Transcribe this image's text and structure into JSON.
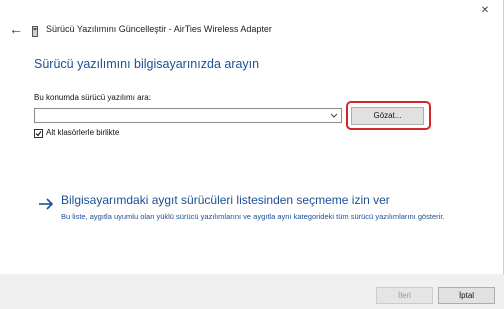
{
  "window": {
    "title": "Sürücü Yazılımını Güncelleştir - AirTies Wireless Adapter",
    "close_glyph": "✕",
    "back_glyph": "←",
    "back_icon": "back-arrow-icon",
    "app_icon": "device-driver-icon"
  },
  "main": {
    "heading": "Sürücü yazılımını bilgisayarınızda arayın",
    "path_label": "Bu konumda sürücü yazılımı ara:",
    "path_value": "",
    "browse_label": "Gözat...",
    "include_subfolders_label": "Alt klasörlerle birlikte",
    "include_subfolders_checked": true
  },
  "pick_option": {
    "title": "Bilgisayarımdaki aygıt sürücüleri listesinden seçmeme izin ver",
    "description": "Bu liste, aygıtla uyumlu olan yüklü sürücü yazılımlarını ve aygıtla aynı kategorideki tüm sürücü yazılımlarını gösterir.",
    "icon": "arrow-right-icon"
  },
  "footer": {
    "next_label": "İleri",
    "cancel_label": "İptal",
    "next_enabled": false
  },
  "colors": {
    "link_blue": "#1b4f96",
    "highlight_red": "#d3262b"
  }
}
